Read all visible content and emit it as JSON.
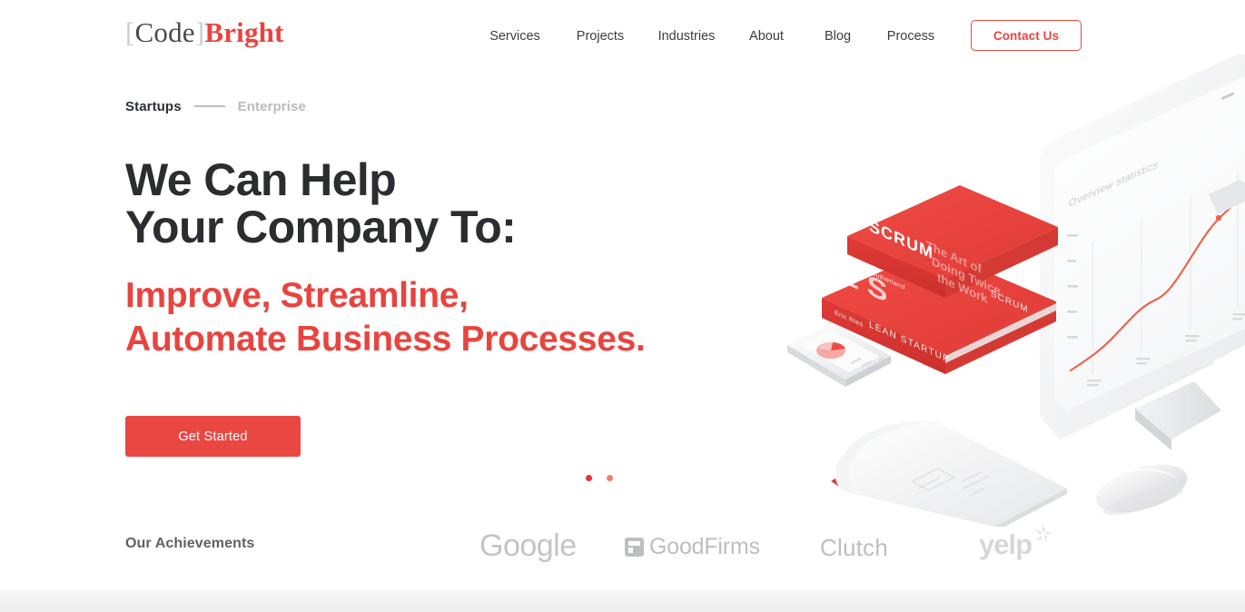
{
  "brand": {
    "bracket_open": "[",
    "name_dark": "Code",
    "bracket_close": "]",
    "name_accent": "Bright",
    "accent_color": "#e8443f",
    "dark_color": "#4a4a4a"
  },
  "nav": {
    "items": [
      {
        "label": "Services"
      },
      {
        "label": "Projects"
      },
      {
        "label": "Industries"
      },
      {
        "label": "About"
      },
      {
        "label": "Blog"
      },
      {
        "label": "Process"
      }
    ],
    "cta_label": "Contact Us"
  },
  "hero": {
    "segment_toggle": {
      "active": "Startups",
      "inactive": "Enterprise"
    },
    "headline": "We Can Help\nYour Company To:",
    "subheadline": "Improve, Streamline,\nAutomate Business Processes.",
    "cta_label": "Get Started",
    "carousel": {
      "slides": 2,
      "active_index": 0
    }
  },
  "achievements": {
    "label": "Our Achievements",
    "logos": [
      {
        "name": "Google"
      },
      {
        "name": "GoodFirms"
      },
      {
        "name": "Clutch"
      },
      {
        "name": "yelp"
      }
    ]
  },
  "illustration": {
    "monitor": {
      "chart_title": "Overview statistics",
      "tooltip": "",
      "line_color": "#ef5f4a"
    },
    "books": [
      {
        "title": "SCRUM",
        "subtitle": "The Art of Doing Twice the Work in Half the Time",
        "author": "Jeff Sutherland",
        "spine": "SCRUM"
      },
      {
        "title": "LEAN STARTUP",
        "author": "Eric Ries",
        "spine": "LEAN STARTUP"
      }
    ],
    "devices": [
      "smartphone-pie-chart",
      "notebook",
      "computer-mouse"
    ]
  },
  "colors": {
    "accent_red": "#e8443f",
    "button_red": "#ea4743",
    "heading_dark": "#2b2d30",
    "muted_gray": "#bcbcbc",
    "logo_gray": "#bdbec0"
  }
}
